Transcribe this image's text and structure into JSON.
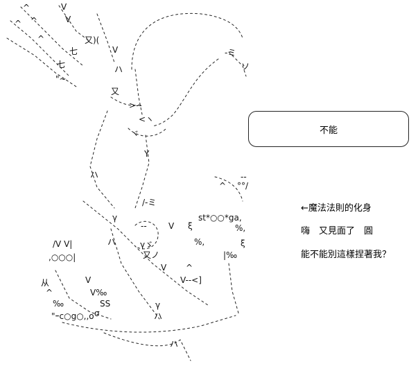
{
  "speech_bubble": {
    "text": "不能"
  },
  "captions": [
    "←魔法法則的化身",
    "嗨　又見面了　圓",
    "能不能別這樣捏著我？"
  ],
  "ascii_art": {
    "fragments": [
      ")(",
      "^",
      "V",
      "^",
      "V",
      "^",
      "^",
      "\\",
      "V",
      "\\",
      "\\",
      "又",
      "(",
      "七",
      "V",
      "ノ",
      "七",
      "、",
      "\"",
      "~",
      "..",
      "ミ",
      "ソ",
      "/",
      ")",
      "|",
      "又",
      "\\",
      ">",
      "<",
      "/",
      "]",
      "Y",
      "ハ",
      "\\",
      "ミ",
      "/",
      "\\",
      "γ",
      "ヽ",
      "ヾ",
      "st*○○*ga",
      "ξ",
      "%",
      "|",
      "/",
      "%",
      "ξ",
      "V",
      "V",
      "%",
      "ハ",
      "|‰",
      "V",
      "〈",
      "ゞ",
      "/V V|",
      ",○○○|",
      "从",
      "^",
      "V",
      "‰",
      "V‰",
      "SS",
      "‰",
      "\"ｰc○g○,,o",
      "σ",
      "ハ",
      "ノ",
      "/"
    ]
  }
}
